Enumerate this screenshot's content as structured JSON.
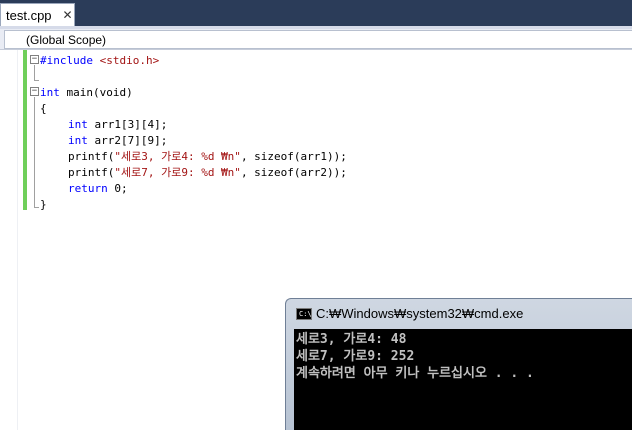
{
  "tab": {
    "label": "test.cpp",
    "close": "✕"
  },
  "scope": {
    "label": "(Global Scope)"
  },
  "code": {
    "l1": {
      "pre": "#include",
      "inc": "<stdio.h>"
    },
    "l3": {
      "kw": "int",
      "rest": "main(void)"
    },
    "l4": "{",
    "l5": {
      "kw": "int",
      "rest": "arr1[3][4];"
    },
    "l6": {
      "kw": "int",
      "rest": "arr2[7][9];"
    },
    "l7": {
      "fn": "printf(",
      "str": "\"세로3, 가로4: %d ₩n\"",
      "rest": ", sizeof(arr1));"
    },
    "l8": {
      "fn": "printf(",
      "str": "\"세로7, 가로9: %d ₩n\"",
      "rest": ", sizeof(arr2));"
    },
    "l9": {
      "kw": "return",
      "rest": "0;"
    },
    "l10": "}"
  },
  "console": {
    "icon_text": "C:\\",
    "title": "C:₩Windows₩system32₩cmd.exe",
    "lines": [
      "세로3, 가로4: 48",
      "세로7, 가로9: 252",
      "계속하려면 아무 키나 누르십시오 . . ."
    ]
  }
}
